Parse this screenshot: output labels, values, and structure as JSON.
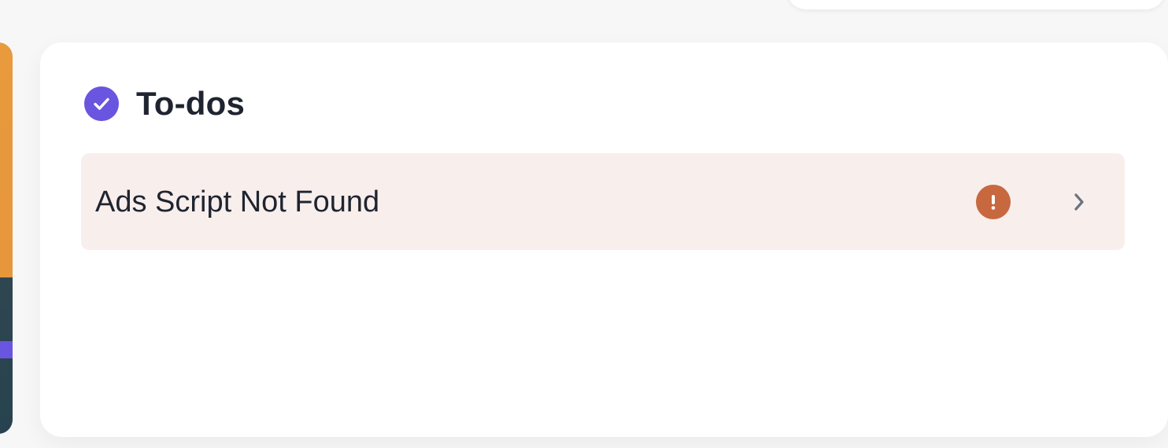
{
  "todos": {
    "title": "To-dos",
    "header_icon": "check-circle-icon",
    "items": [
      {
        "label": "Ads Script Not Found",
        "status_icon": "alert-icon",
        "action_icon": "chevron-right-icon"
      }
    ]
  },
  "colors": {
    "accent": "#6a55e0",
    "alert": "#c8683f",
    "item_background": "#f8efed",
    "text": "#1f2430"
  }
}
